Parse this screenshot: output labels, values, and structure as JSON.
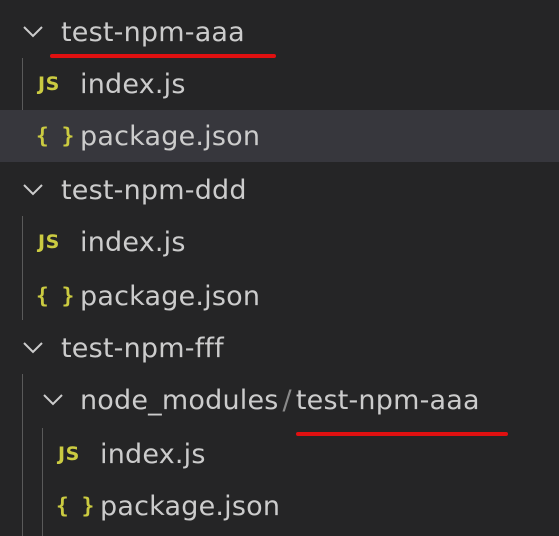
{
  "explorer": {
    "folder_aaa": {
      "label": "test-npm-aaa",
      "expanded": true
    },
    "folder_aaa_files": {
      "index": "index.js",
      "package": "package.json"
    },
    "folder_ddd": {
      "label": "test-npm-ddd",
      "expanded": true
    },
    "folder_ddd_files": {
      "index": "index.js",
      "package": "package.json"
    },
    "folder_fff": {
      "label": "test-npm-fff",
      "expanded": true
    },
    "nested": {
      "parent": "node_modules",
      "separator": "/",
      "child": "test-npm-aaa",
      "expanded": true
    },
    "nested_files": {
      "index": "index.js",
      "package": "package.json"
    }
  },
  "icons": {
    "js_glyph": "JS",
    "json_glyph": "{ }"
  },
  "colors": {
    "background": "#252526",
    "selected_row": "#37373d",
    "text": "#cccccc",
    "icon_yellow": "#cbcb41",
    "annotation_red": "#e01010"
  }
}
